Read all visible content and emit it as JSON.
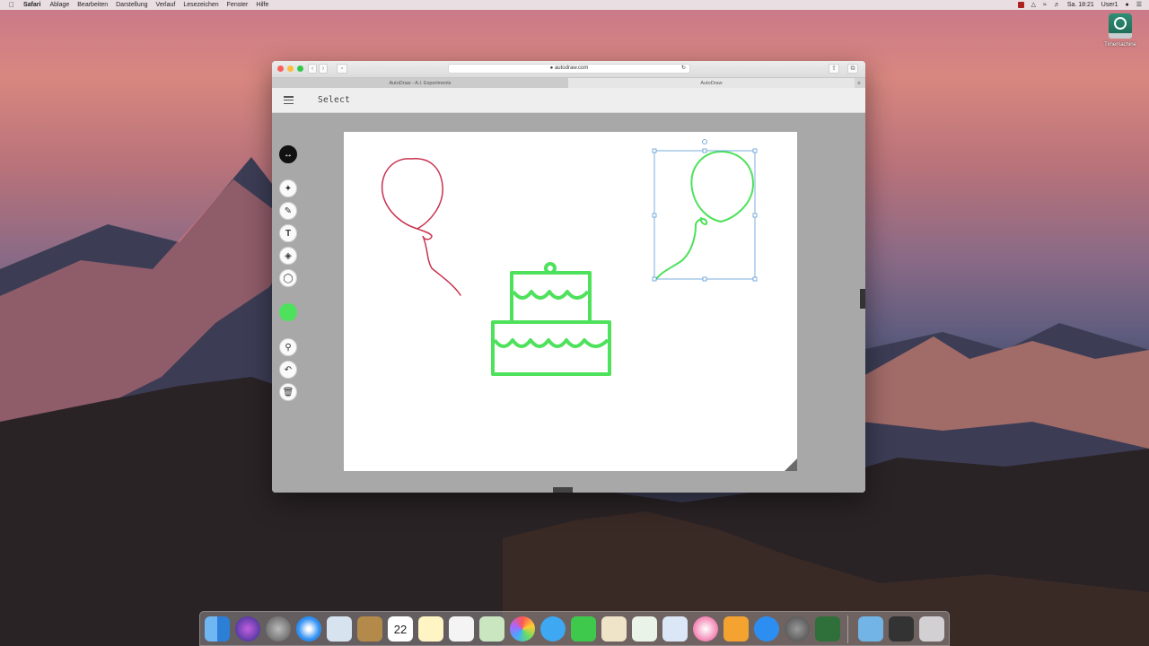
{
  "menubar": {
    "app_name": "Safari",
    "items": [
      "Ablage",
      "Bearbeiten",
      "Darstellung",
      "Verlauf",
      "Lesezeichen",
      "Fenster",
      "Hilfe"
    ],
    "clock": "Sa. 18:21",
    "user": "User1"
  },
  "desktop": {
    "time_machine_label": "Timemachine"
  },
  "browser": {
    "url": "autodraw.com",
    "tabs": [
      {
        "label": "AutoDraw - A.I. Experiments",
        "active": false
      },
      {
        "label": "AutoDraw",
        "active": true
      }
    ]
  },
  "app": {
    "mode_label": "Select",
    "tools": [
      {
        "name": "select",
        "icon": "move-arrows-icon",
        "selected": true
      },
      {
        "name": "autodraw",
        "icon": "autodraw-sparkle-icon",
        "selected": false
      },
      {
        "name": "draw",
        "icon": "pencil-icon",
        "selected": false
      },
      {
        "name": "type",
        "icon": "text-T-icon",
        "selected": false
      },
      {
        "name": "fill",
        "icon": "fill-bucket-icon",
        "selected": false
      },
      {
        "name": "shape",
        "icon": "shape-icon",
        "selected": false
      },
      {
        "name": "color",
        "icon": "color-swatch",
        "selected": false
      },
      {
        "name": "zoom",
        "icon": "zoom-icon",
        "selected": false
      },
      {
        "name": "undo",
        "icon": "undo-icon",
        "selected": false
      },
      {
        "name": "delete",
        "icon": "trash-icon",
        "selected": false
      }
    ],
    "active_color": "#4ee15b",
    "drawings": [
      {
        "name": "balloon-sketch",
        "color": "#c8324e"
      },
      {
        "name": "cake",
        "color": "#4ee15b"
      },
      {
        "name": "balloon-selected",
        "color": "#4ee15b"
      }
    ]
  },
  "dock": {
    "calendar_day": "22"
  }
}
